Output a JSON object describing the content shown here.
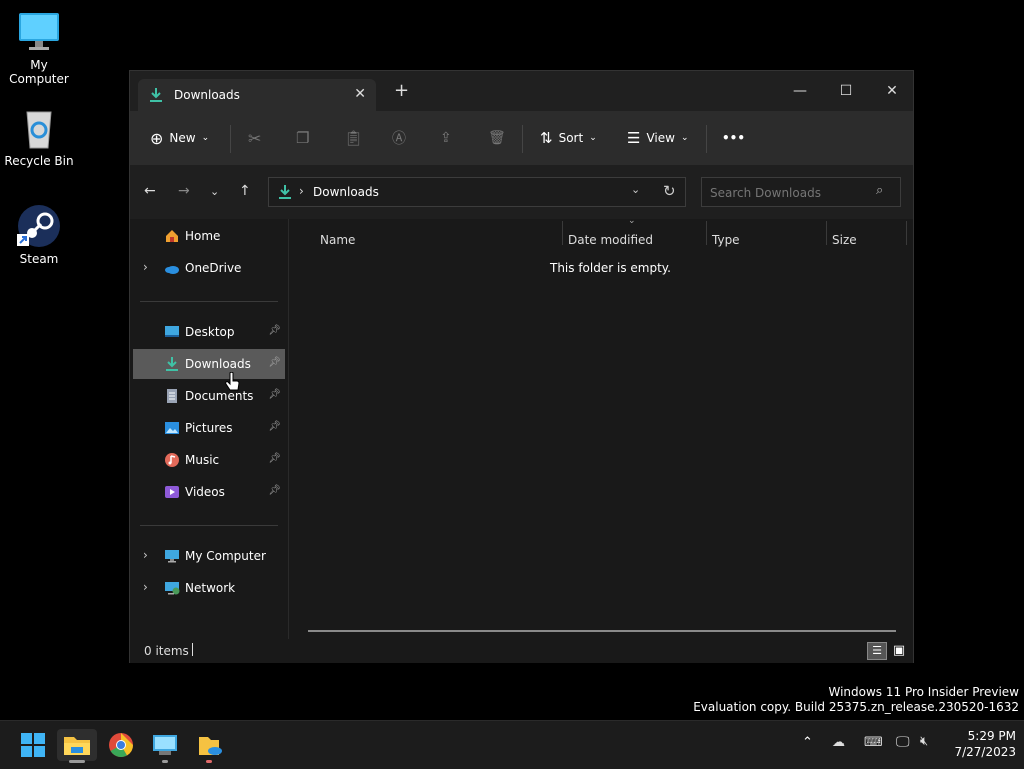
{
  "desktop": {
    "icons": [
      {
        "label": "My Computer",
        "icon": "monitor-icon"
      },
      {
        "label": "Recycle Bin",
        "icon": "recycle-bin-icon"
      },
      {
        "label": "Steam",
        "icon": "steam-icon"
      }
    ]
  },
  "window": {
    "tab_title": "Downloads",
    "toolbar": {
      "new_label": "New",
      "sort_label": "Sort",
      "view_label": "View",
      "more_label": "•••"
    },
    "address": {
      "current": "Downloads",
      "separator": "›"
    },
    "search": {
      "placeholder": "Search Downloads"
    },
    "sidebar": {
      "top": [
        {
          "label": "Home",
          "icon": "home-icon",
          "chevron": false
        },
        {
          "label": "OneDrive",
          "icon": "cloud-icon",
          "chevron": true
        }
      ],
      "quick": [
        {
          "label": "Desktop",
          "icon": "desktop-icon"
        },
        {
          "label": "Downloads",
          "icon": "download-icon",
          "selected": true
        },
        {
          "label": "Documents",
          "icon": "document-icon"
        },
        {
          "label": "Pictures",
          "icon": "pictures-icon"
        },
        {
          "label": "Music",
          "icon": "music-icon"
        },
        {
          "label": "Videos",
          "icon": "video-icon"
        }
      ],
      "bottom": [
        {
          "label": "My Computer",
          "icon": "computer-icon"
        },
        {
          "label": "Network",
          "icon": "network-icon"
        }
      ]
    },
    "columns": [
      "Name",
      "Date modified",
      "Type",
      "Size"
    ],
    "empty_message": "This folder is empty.",
    "status": {
      "items": "0 items"
    }
  },
  "watermark": {
    "line1": "Windows 11 Pro Insider Preview",
    "line2": "Evaluation copy. Build 25375.zn_release.230520-1632"
  },
  "taskbar": {
    "time": "5:29 PM",
    "date": "7/27/2023"
  },
  "colors": {
    "accent_teal": "#3fc1a6",
    "window_bg": "#191919",
    "selection": "#5a5a5a"
  }
}
